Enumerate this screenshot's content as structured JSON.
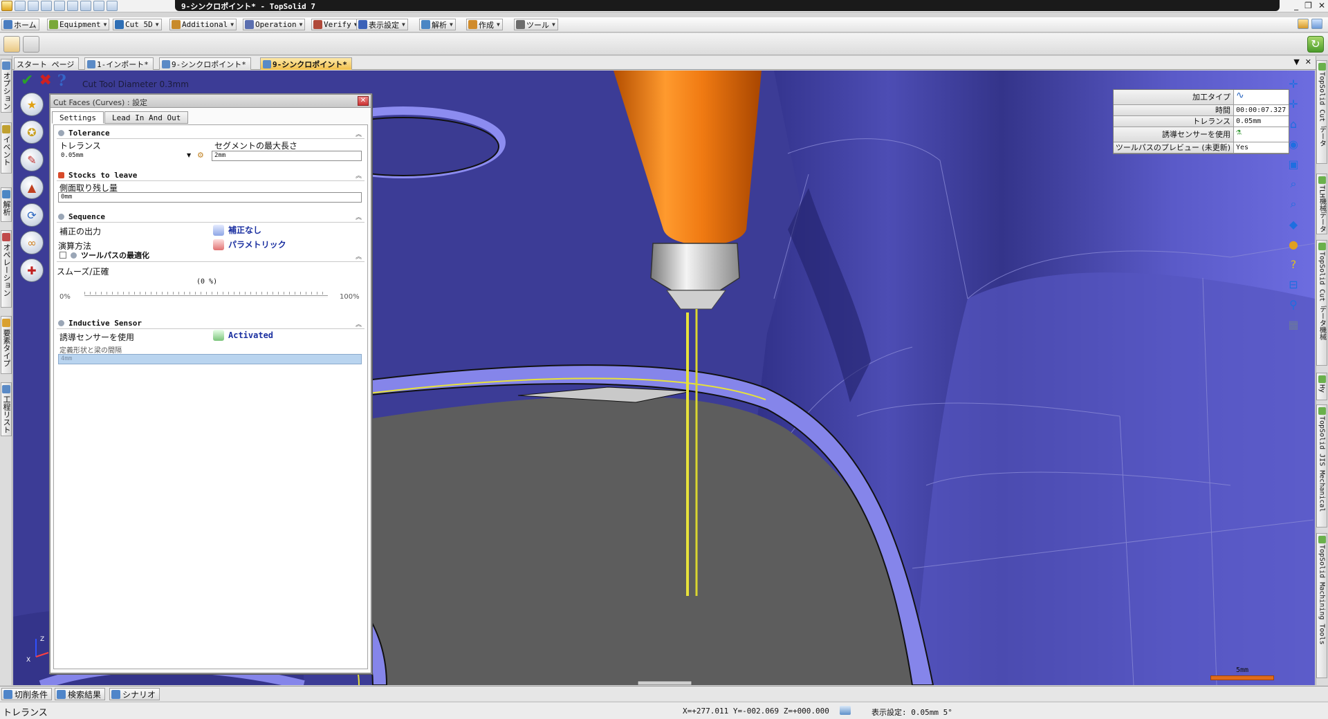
{
  "window": {
    "title": "9-シンクロポイント* - TopSolid 7"
  },
  "ribbon": {
    "tabs": [
      {
        "label": "ホーム",
        "color": "#4a7dc0"
      },
      {
        "label": "Equipment",
        "color": "#7aa83a"
      },
      {
        "label": "Cut 5D",
        "color": "#2f6fb5"
      },
      {
        "label": "Additional",
        "color": "#c88a2a"
      },
      {
        "label": "Operation",
        "color": "#5b6fb0"
      },
      {
        "label": "Verify",
        "color": "#b04a3a"
      },
      {
        "label": "表示設定",
        "color": "#3c62b8"
      },
      {
        "label": "解析",
        "color": "#4b86c4"
      },
      {
        "label": "作成",
        "color": "#d08b2b"
      },
      {
        "label": "ツール",
        "color": "#6c6c6c"
      }
    ]
  },
  "doc_tabs": [
    {
      "label": "スタート ページ"
    },
    {
      "label": "1-インポート*"
    },
    {
      "label": "9-シンクロポイント*"
    },
    {
      "label": "9-シンクロポイント*"
    }
  ],
  "left_panel_tabs": [
    "オプション",
    "イベント",
    "解析",
    "オペレーション",
    "要素タイプ",
    "工程リスト"
  ],
  "right_panel_tabs": [
    "TopSolid Cut データ",
    "TLH機械データ",
    "TopSolid Cut データ機械",
    "Hy",
    "TopSolid JIS Mechanical",
    "TopSolid Machining Tools"
  ],
  "command": {
    "ok_icon": "✔",
    "cancel_icon": "✖",
    "help_icon": "?",
    "info": "Cut Tool Diameter 0.3mm"
  },
  "dialog": {
    "title": "Cut Faces (Curves) : 設定",
    "tabs": [
      "Settings",
      "Lead In And Out"
    ],
    "tolerance": {
      "header": "Tolerance",
      "tolerance_label": "トレランス",
      "tolerance_value": "0.05mm",
      "segment_label": "セグメントの最大長さ",
      "segment_value": "2mm"
    },
    "stocks": {
      "header": "Stocks to leave",
      "side_label": "側面取り残し量",
      "side_value": "0mm"
    },
    "sequence": {
      "header": "Sequence",
      "comp_label": "補正の出力",
      "comp_value": "補正なし",
      "interp_label": "演算方法",
      "interp_value": "パラメトリック"
    },
    "toolpath": {
      "header": "ツールパスの最適化",
      "smooth_label": "スムーズ/正確",
      "percent_display": "(0 %)",
      "min": "0%",
      "max": "100%"
    },
    "sensor": {
      "header": "Inductive Sensor",
      "use_label": "誘導センサーを使用",
      "use_value": "Activated",
      "gap_label": "定義形状と梁の間隔",
      "gap_value": "4mm"
    }
  },
  "properties": [
    {
      "key": "加工タイプ",
      "value": ""
    },
    {
      "key": "時間",
      "value": "00:00:07.327"
    },
    {
      "key": "トレランス",
      "value": "0.05mm"
    },
    {
      "key": "誘導センサーを使用",
      "value": ""
    },
    {
      "key": "ツールパスのプレビュー (未更新)",
      "value": "Yes"
    }
  ],
  "view_tools": [
    "move-icon",
    "move-icon",
    "home-view-icon",
    "camera-icon",
    "window-icon",
    "zoom-icon",
    "zoom-all-icon",
    "cube-icon",
    "palette-icon",
    "help-icon",
    "hide-icon",
    "pin-icon",
    "grid-icon"
  ],
  "scale": {
    "label": "5mm"
  },
  "triad": {
    "z": "Z",
    "x": "X"
  },
  "bottom_tabs": [
    "切削条件",
    "検索結果",
    "シナリオ"
  ],
  "status": {
    "left": "トレランス",
    "coords": "X=+277.011  Y=-002.069  Z=+000.000",
    "display": "表示設定: 0.05mm 5°"
  },
  "colors": {
    "viewport": "#3f3f99",
    "tool_orange": "#f07a12",
    "toolpath_yellow": "#e7e23a",
    "part_gray": "#5d5d5d",
    "part_edge": "#8c8cf0"
  }
}
